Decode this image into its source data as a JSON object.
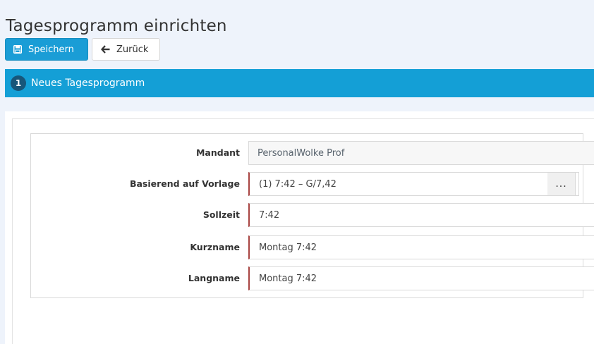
{
  "page": {
    "title": "Tagesprogramm einrichten"
  },
  "toolbar": {
    "save_label": "Speichern",
    "back_label": "Zurück"
  },
  "wizard": {
    "step_number": "1",
    "step_label": "Neues Tagesprogramm"
  },
  "form": {
    "mandant": {
      "label": "Mandant",
      "value": "PersonalWolke Prof"
    },
    "vorlage": {
      "label": "Basierend auf Vorlage",
      "value": "(1) 7:42 – G/7,42",
      "button_label": "..."
    },
    "sollzeit": {
      "label": "Sollzeit",
      "value": "7:42"
    },
    "kurzname": {
      "label": "Kurzname",
      "value": "Montag 7:42"
    },
    "langname": {
      "label": "Langname",
      "value": "Montag 7:42"
    }
  },
  "colors": {
    "primary": "#1a9dd6",
    "step_bar": "#149fd6",
    "step_badge": "#17567a",
    "required_marker": "#a94442"
  },
  "icons": {
    "save": "floppy-disk-icon",
    "back": "arrow-left-icon",
    "select": "chevron-down-icon"
  }
}
